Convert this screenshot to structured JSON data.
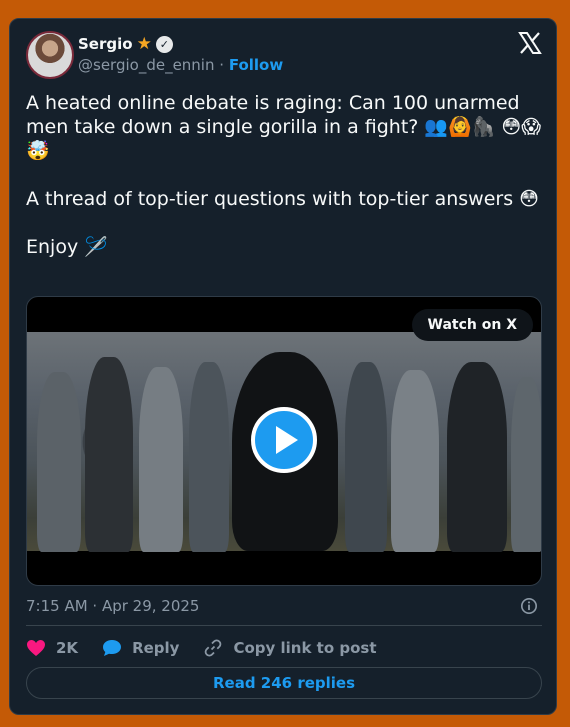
{
  "author": {
    "name": "Sergio",
    "badge_icon": "star-icon",
    "verified_icon": "verified-check-icon",
    "handle": "@sergio_de_ennin",
    "separator": "·",
    "follow_label": "Follow"
  },
  "post": {
    "line1": "A heated online debate is raging: Can 100 unarmed men take down a single gorilla in a fight? 👥🙆🦍 😳😱🤯",
    "line2": "A thread of top-tier questions with top-tier answers 😳",
    "line3": "Enjoy 🪡"
  },
  "media": {
    "watch_label": "Watch on X",
    "play_icon": "play-icon"
  },
  "timestamp": "7:15 AM · Apr 29, 2025",
  "actions": {
    "like_count": "2K",
    "reply_label": "Reply",
    "copy_label": "Copy link to post"
  },
  "read_replies_label": "Read 246 replies",
  "colors": {
    "background": "#c45a06",
    "card": "#15202b",
    "accent": "#1d9bf0",
    "like": "#f91880"
  }
}
